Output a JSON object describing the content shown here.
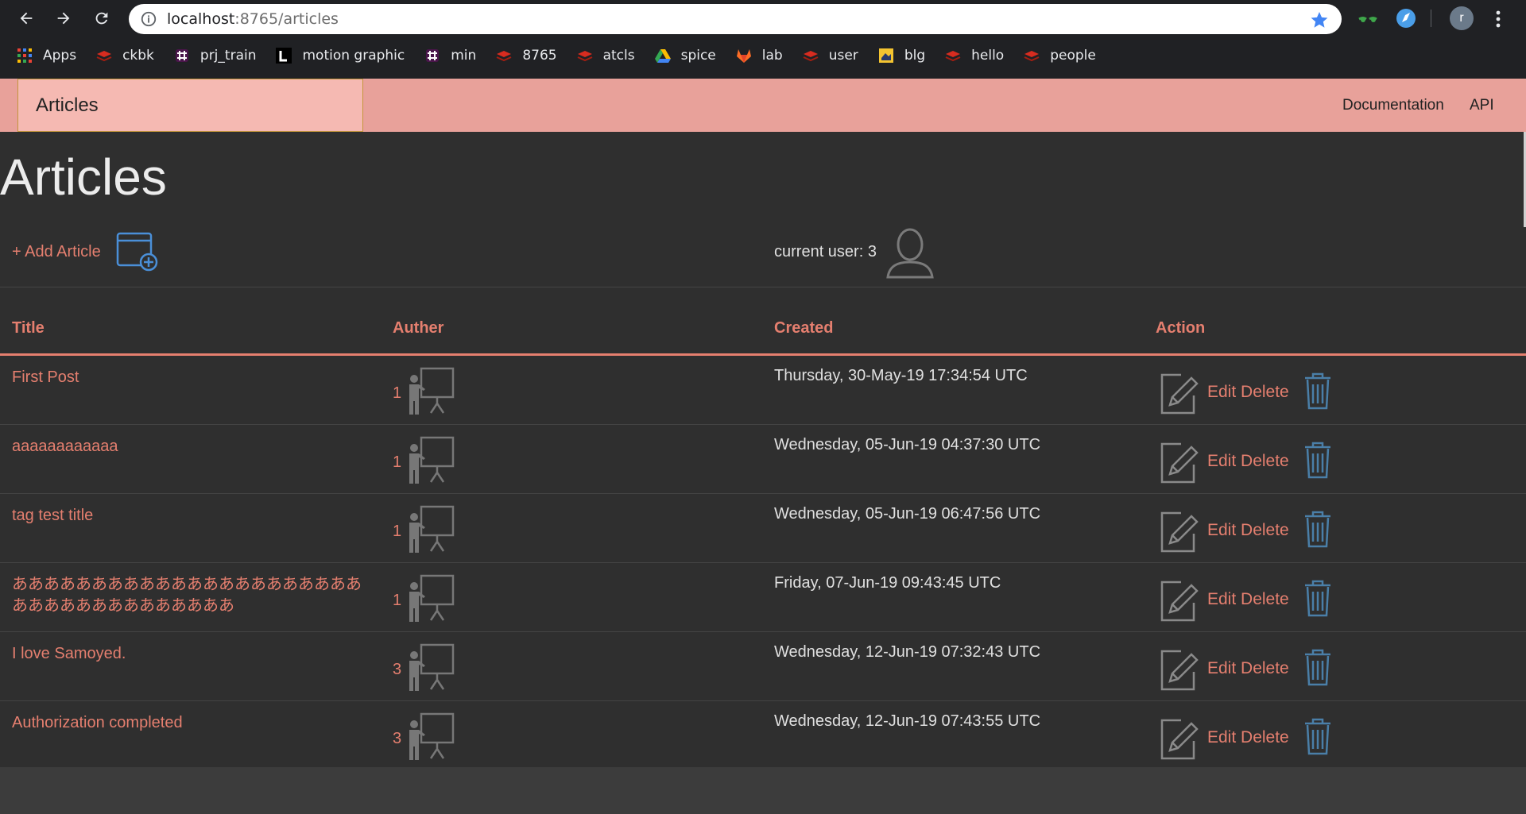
{
  "browser": {
    "url_host": "localhost",
    "url_rest": ":8765/articles",
    "avatar_letter": "r",
    "bookmarks": [
      {
        "label": "Apps",
        "icon": "apps-grid-icon"
      },
      {
        "label": "ckbk",
        "icon": "redis-icon"
      },
      {
        "label": "prj_train",
        "icon": "slack-icon"
      },
      {
        "label": "motion graphic",
        "icon": "l-logo-icon"
      },
      {
        "label": "min",
        "icon": "slack-icon"
      },
      {
        "label": "8765",
        "icon": "redis-icon"
      },
      {
        "label": "atcls",
        "icon": "redis-icon"
      },
      {
        "label": "spice",
        "icon": "google-drive-icon"
      },
      {
        "label": "lab",
        "icon": "gitlab-icon"
      },
      {
        "label": "user",
        "icon": "redis-icon"
      },
      {
        "label": "blg",
        "icon": "blog-icon"
      },
      {
        "label": "hello",
        "icon": "redis-icon"
      },
      {
        "label": "people",
        "icon": "redis-icon"
      }
    ]
  },
  "navbar": {
    "brand": "Articles",
    "links": [
      "Documentation",
      "API"
    ]
  },
  "page": {
    "title": "Articles",
    "add_article": "+ Add Article",
    "current_user": "current user: 3"
  },
  "table": {
    "headers": [
      "Title",
      "Auther",
      "Created",
      "Action"
    ],
    "edit_label": "Edit",
    "delete_label": "Delete",
    "rows": [
      {
        "title": "First Post",
        "author": "1",
        "created": "Thursday, 30-May-19 17:34:54 UTC"
      },
      {
        "title": "aaaaaaaaaaaa",
        "author": "1",
        "created": "Wednesday, 05-Jun-19 04:37:30 UTC"
      },
      {
        "title": "tag test title",
        "author": "1",
        "created": "Wednesday, 05-Jun-19 06:47:56 UTC"
      },
      {
        "title": "ああああああああああああああああああああああああああああああああああああ",
        "author": "1",
        "created": "Friday, 07-Jun-19 09:43:45 UTC"
      },
      {
        "title": "I love Samoyed.",
        "author": "3",
        "created": "Wednesday, 12-Jun-19 07:32:43 UTC"
      },
      {
        "title": "Authorization completed",
        "author": "3",
        "created": "Wednesday, 12-Jun-19 07:43:55 UTC"
      }
    ]
  },
  "colors": {
    "accent": "#e57f6f",
    "navbar": "#e8a19a",
    "brand_bg": "#f5b9b2",
    "content_bg": "#2f2f2f",
    "trash": "#4a7fa8"
  }
}
